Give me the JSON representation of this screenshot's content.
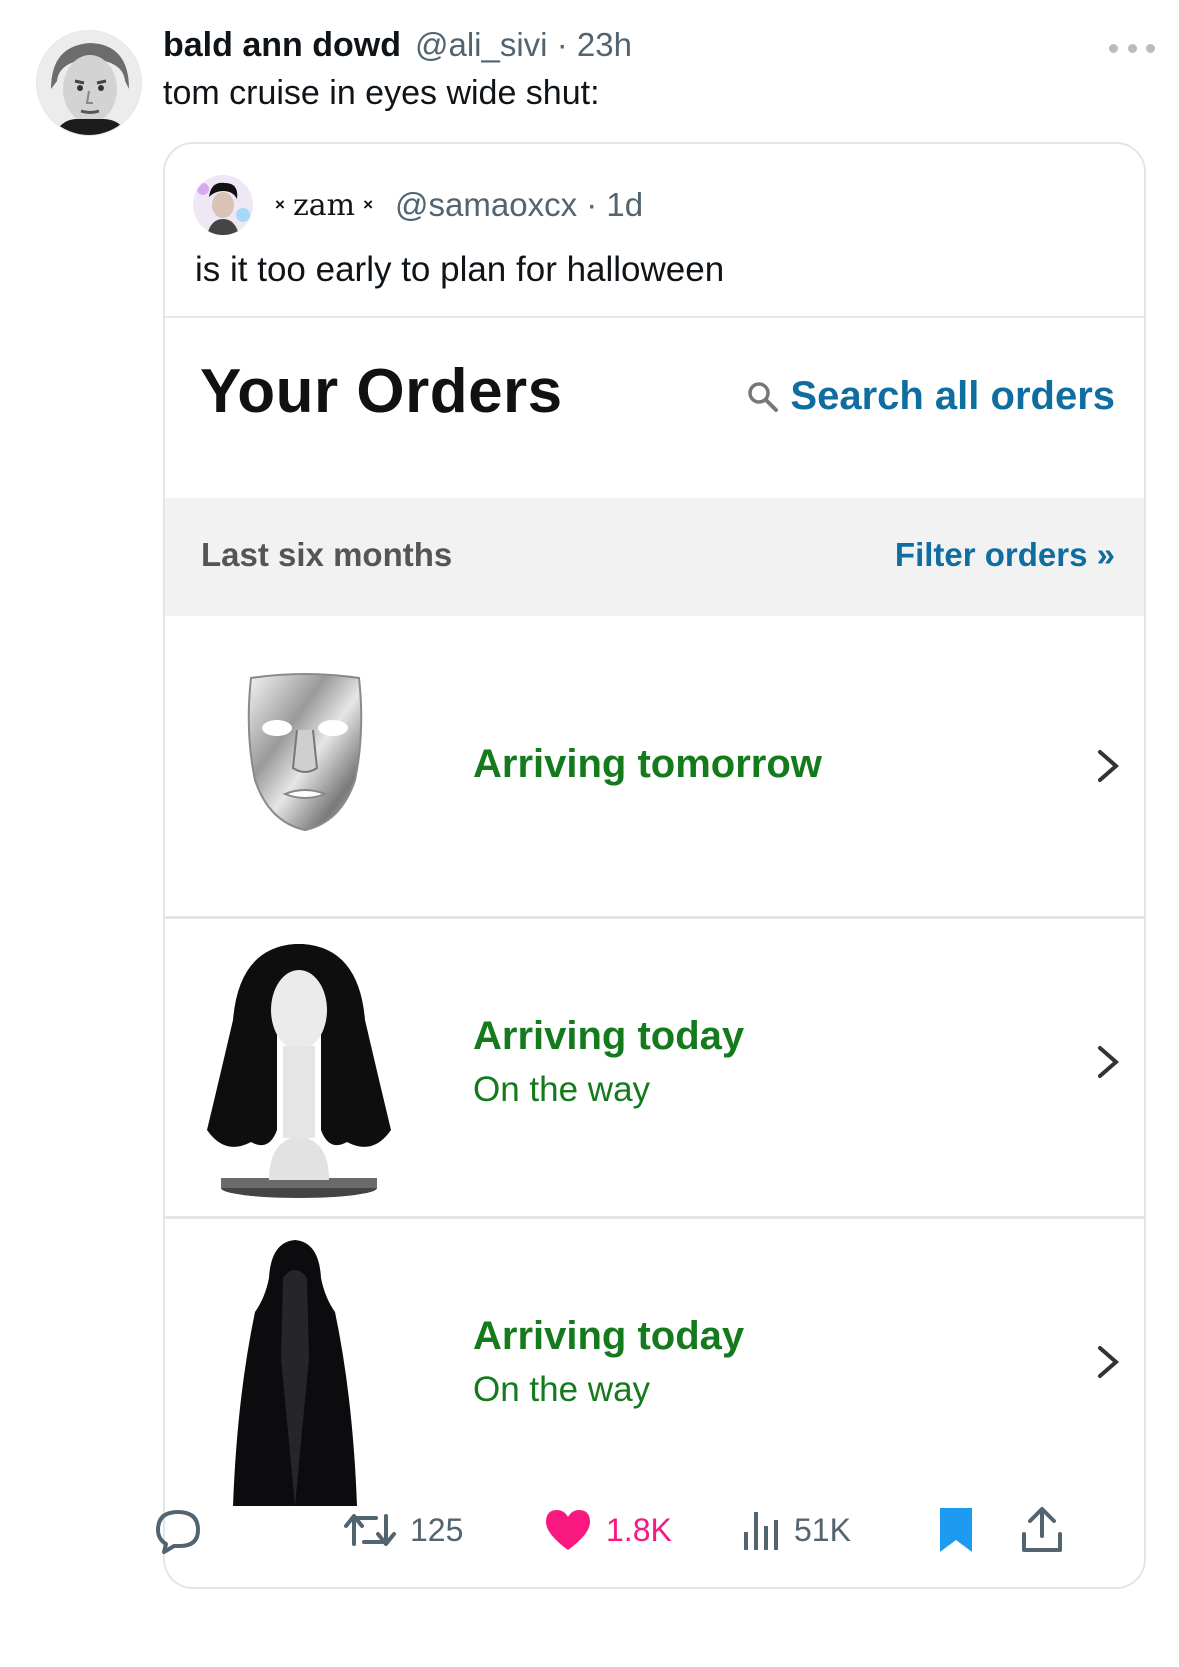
{
  "tweet": {
    "display_name": "bald ann dowd",
    "handle": "@ali_sivi",
    "time": "23h",
    "text": "tom cruise in eyes wide shut:"
  },
  "quote": {
    "display_name": "zam",
    "decoration": "×",
    "handle": "@samaoxcx",
    "time": "1d",
    "text": "is it too early to plan for halloween"
  },
  "orders": {
    "title": "Your Orders",
    "search_label": "Search all orders",
    "period": "Last six months",
    "filter_label": "Filter orders »",
    "items": [
      {
        "image": "silver-mask",
        "status": "Arriving tomorrow",
        "substatus": ""
      },
      {
        "image": "black-wig",
        "status": "Arriving today",
        "substatus": "On the way"
      },
      {
        "image": "black-cloak",
        "status": "Arriving today",
        "substatus": "On the way"
      }
    ]
  },
  "actions": {
    "reply_count": "",
    "retweet_count": "125",
    "like_count": "1.8K",
    "views_count": "51K"
  },
  "colors": {
    "link_blue": "#0f6e9f",
    "status_green": "#147a1c",
    "like_pink": "#f91880",
    "bookmark_blue": "#1d9bf0",
    "muted_gray": "#536471"
  }
}
